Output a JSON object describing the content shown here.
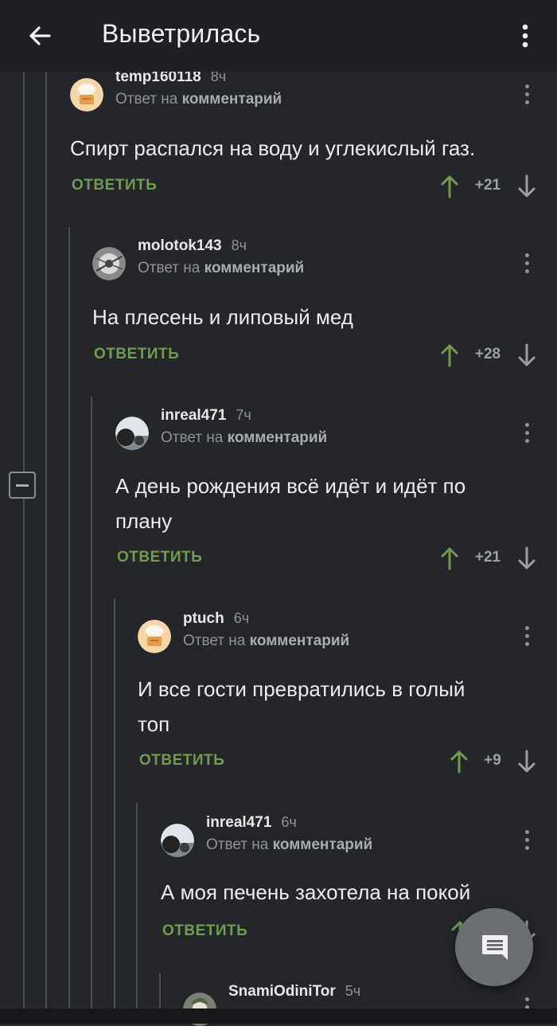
{
  "header": {
    "title": "Выветрилась"
  },
  "comments": [
    {
      "username": "temp160118",
      "time": "8ч",
      "reply_prefix": "Ответ на",
      "reply_target": "комментарий",
      "text_lines": [
        "Спирт распался на воду и углекислый газ."
      ],
      "reply_label": "ОТВЕТИТЬ",
      "score": "+21",
      "avatar": "chef-icon"
    },
    {
      "username": "molotok143",
      "time": "8ч",
      "reply_prefix": "Ответ на",
      "reply_target": "комментарий",
      "text_lines": [
        "На плесень и липовый мед"
      ],
      "reply_label": "ОТВЕТИТЬ",
      "score": "+28",
      "avatar": "photo-avatar-grey"
    },
    {
      "username": "inreal471",
      "time": "7ч",
      "reply_prefix": "Ответ на",
      "reply_target": "комментарий",
      "text_lines": [
        "А день рождения всё идёт и идёт по",
        "плану"
      ],
      "reply_label": "ОТВЕТИТЬ",
      "score": "+21",
      "avatar": "photo-avatar-landscape"
    },
    {
      "username": "ptuch",
      "time": "6ч",
      "reply_prefix": "Ответ на",
      "reply_target": "комментарий",
      "text_lines": [
        "И все гости превратились в голый",
        "топ"
      ],
      "reply_label": "ОТВЕТИТЬ",
      "score": "+9",
      "avatar": "chef-icon"
    },
    {
      "username": "inreal471",
      "time": "6ч",
      "reply_prefix": "Ответ на",
      "reply_target": "комментарий",
      "text_lines": [
        "А моя печень захотела на покой"
      ],
      "reply_label": "ОТВЕТИТЬ",
      "score": "",
      "avatar": "photo-avatar-landscape"
    },
    {
      "username": "SnamiOdiniTor",
      "time": "5ч",
      "reply_prefix": "",
      "reply_target": "",
      "text_lines": [],
      "reply_label": "",
      "score": "",
      "avatar": "joker-avatar"
    }
  ],
  "colors": {
    "background": "#242629",
    "topbar": "#1e2023",
    "reply_green": "#6f9c4f",
    "upvote_green": "#6f9c4f",
    "muted": "#8f9296",
    "fab": "#6b6e72"
  },
  "icons": {
    "back": "arrow-left-icon",
    "menu": "more-vertical-icon",
    "collapse": "minus-square-icon",
    "upvote": "arrow-up-icon",
    "downvote": "arrow-down-icon",
    "fab": "comment-icon"
  }
}
